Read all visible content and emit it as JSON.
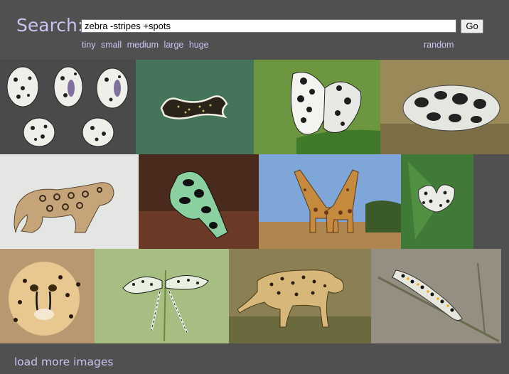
{
  "search": {
    "label": "Search:",
    "query": "zebra -stripes +spots",
    "go_label": "Go"
  },
  "sizes": [
    "tiny",
    "small",
    "medium",
    "large",
    "huge"
  ],
  "random_label": "random",
  "load_more_label": "load more images",
  "images": [
    {
      "name": "spotted-shells-image"
    },
    {
      "name": "spotted-flatworm-image"
    },
    {
      "name": "spotted-butterfly-image"
    },
    {
      "name": "spotted-sea-slug-image"
    },
    {
      "name": "spotted-toy-animal-image"
    },
    {
      "name": "poison-dart-frog-image"
    },
    {
      "name": "giraffes-image"
    },
    {
      "name": "spotted-moth-image"
    },
    {
      "name": "cheetah-face-image"
    },
    {
      "name": "spotted-lacewing-image"
    },
    {
      "name": "walking-cheetah-image"
    },
    {
      "name": "spotted-caterpillar-image"
    }
  ]
}
